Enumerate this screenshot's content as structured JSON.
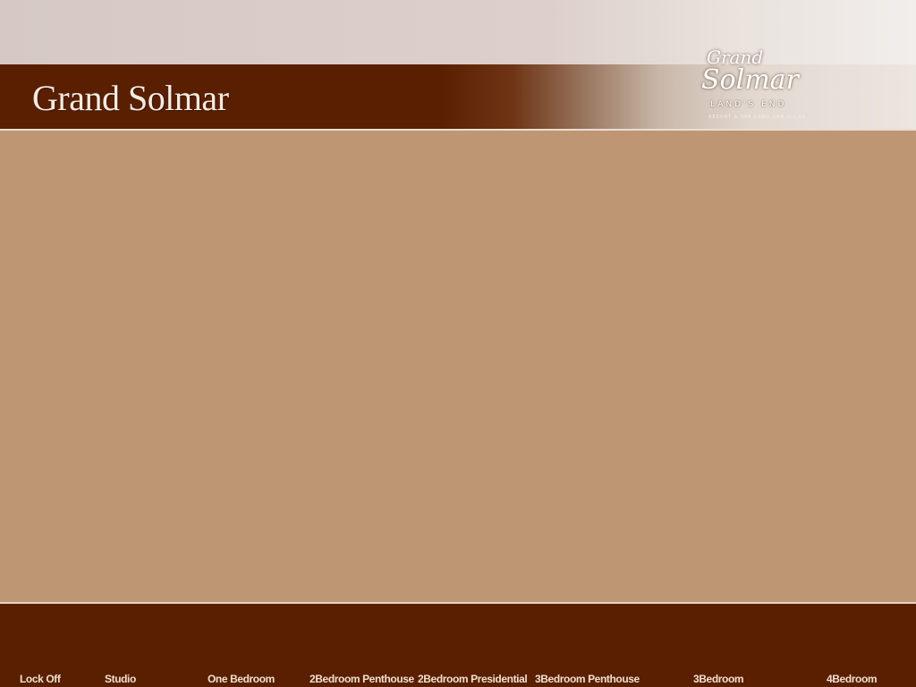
{
  "header": {
    "title": "Grand Solmar",
    "logo": {
      "line1": "Grand",
      "line2": "Solmar",
      "line3": "LAND'S END",
      "tagline": "RESORT & SPA CABO SAN LUCAS"
    }
  },
  "colors": {
    "brand_brown": "#5a1f00",
    "content_tan": "#bf9673",
    "header_light": "#d6c9c3",
    "nav_text": "#efe0cf"
  },
  "nav": {
    "items": [
      {
        "label": "Lock Off"
      },
      {
        "label": "Studio"
      },
      {
        "label": "One Bedroom"
      },
      {
        "label": "2Bedroom Penthouse"
      },
      {
        "label": "2Bedroom Presidential"
      },
      {
        "label": "3Bedroom Penthouse"
      },
      {
        "label": "3Bedroom"
      },
      {
        "label": "4Bedroom"
      }
    ]
  }
}
